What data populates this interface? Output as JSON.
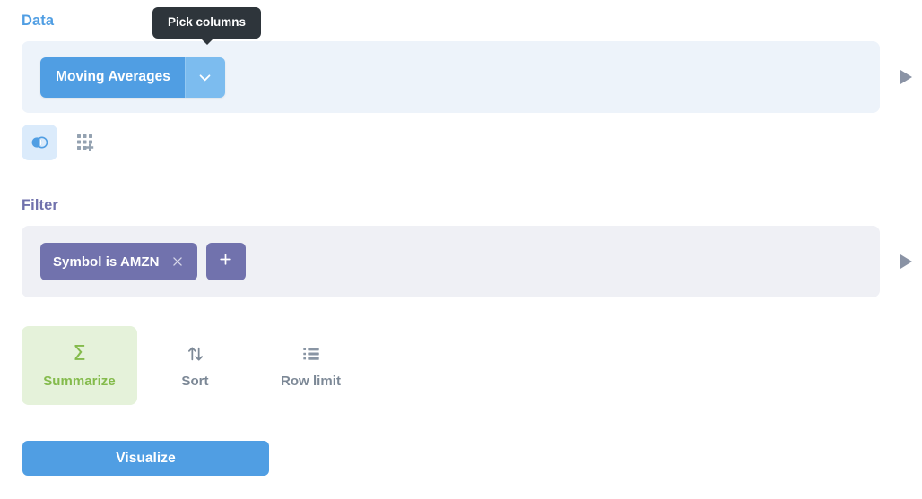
{
  "colors": {
    "data_accent": "#509EE3",
    "data_section_bg": "#EDF3FA",
    "filter_accent": "#7172AD",
    "filter_section_bg": "#EFF0F5",
    "summarize_accent": "#84BB4C",
    "summarize_bg": "#E5F2DA",
    "tooltip_bg": "#2E353B",
    "muted_icon": "#949EAB"
  },
  "tooltip": {
    "text": "Pick columns"
  },
  "data_step": {
    "title": "Data",
    "source_label": "Moving Averages",
    "caret_icon": "chevron-down-icon",
    "preview_icon": "play-icon"
  },
  "data_actions": [
    {
      "name": "join-data-button",
      "icon": "join-icon",
      "active": true
    },
    {
      "name": "custom-column-button",
      "icon": "add-column-icon",
      "active": false
    }
  ],
  "filter_step": {
    "title": "Filter",
    "clauses": [
      {
        "label": "Symbol is AMZN",
        "remove_icon": "close-icon"
      }
    ],
    "add_label": "+",
    "add_icon": "plus-icon",
    "preview_icon": "play-icon"
  },
  "step_actions": [
    {
      "label": "Summarize",
      "icon": "sigma-icon",
      "glyph": "Σ",
      "active": true
    },
    {
      "label": "Sort",
      "icon": "sort-icon",
      "active": false
    },
    {
      "label": "Row limit",
      "icon": "row-limit-icon",
      "active": false
    }
  ],
  "visualize": {
    "label": "Visualize"
  }
}
